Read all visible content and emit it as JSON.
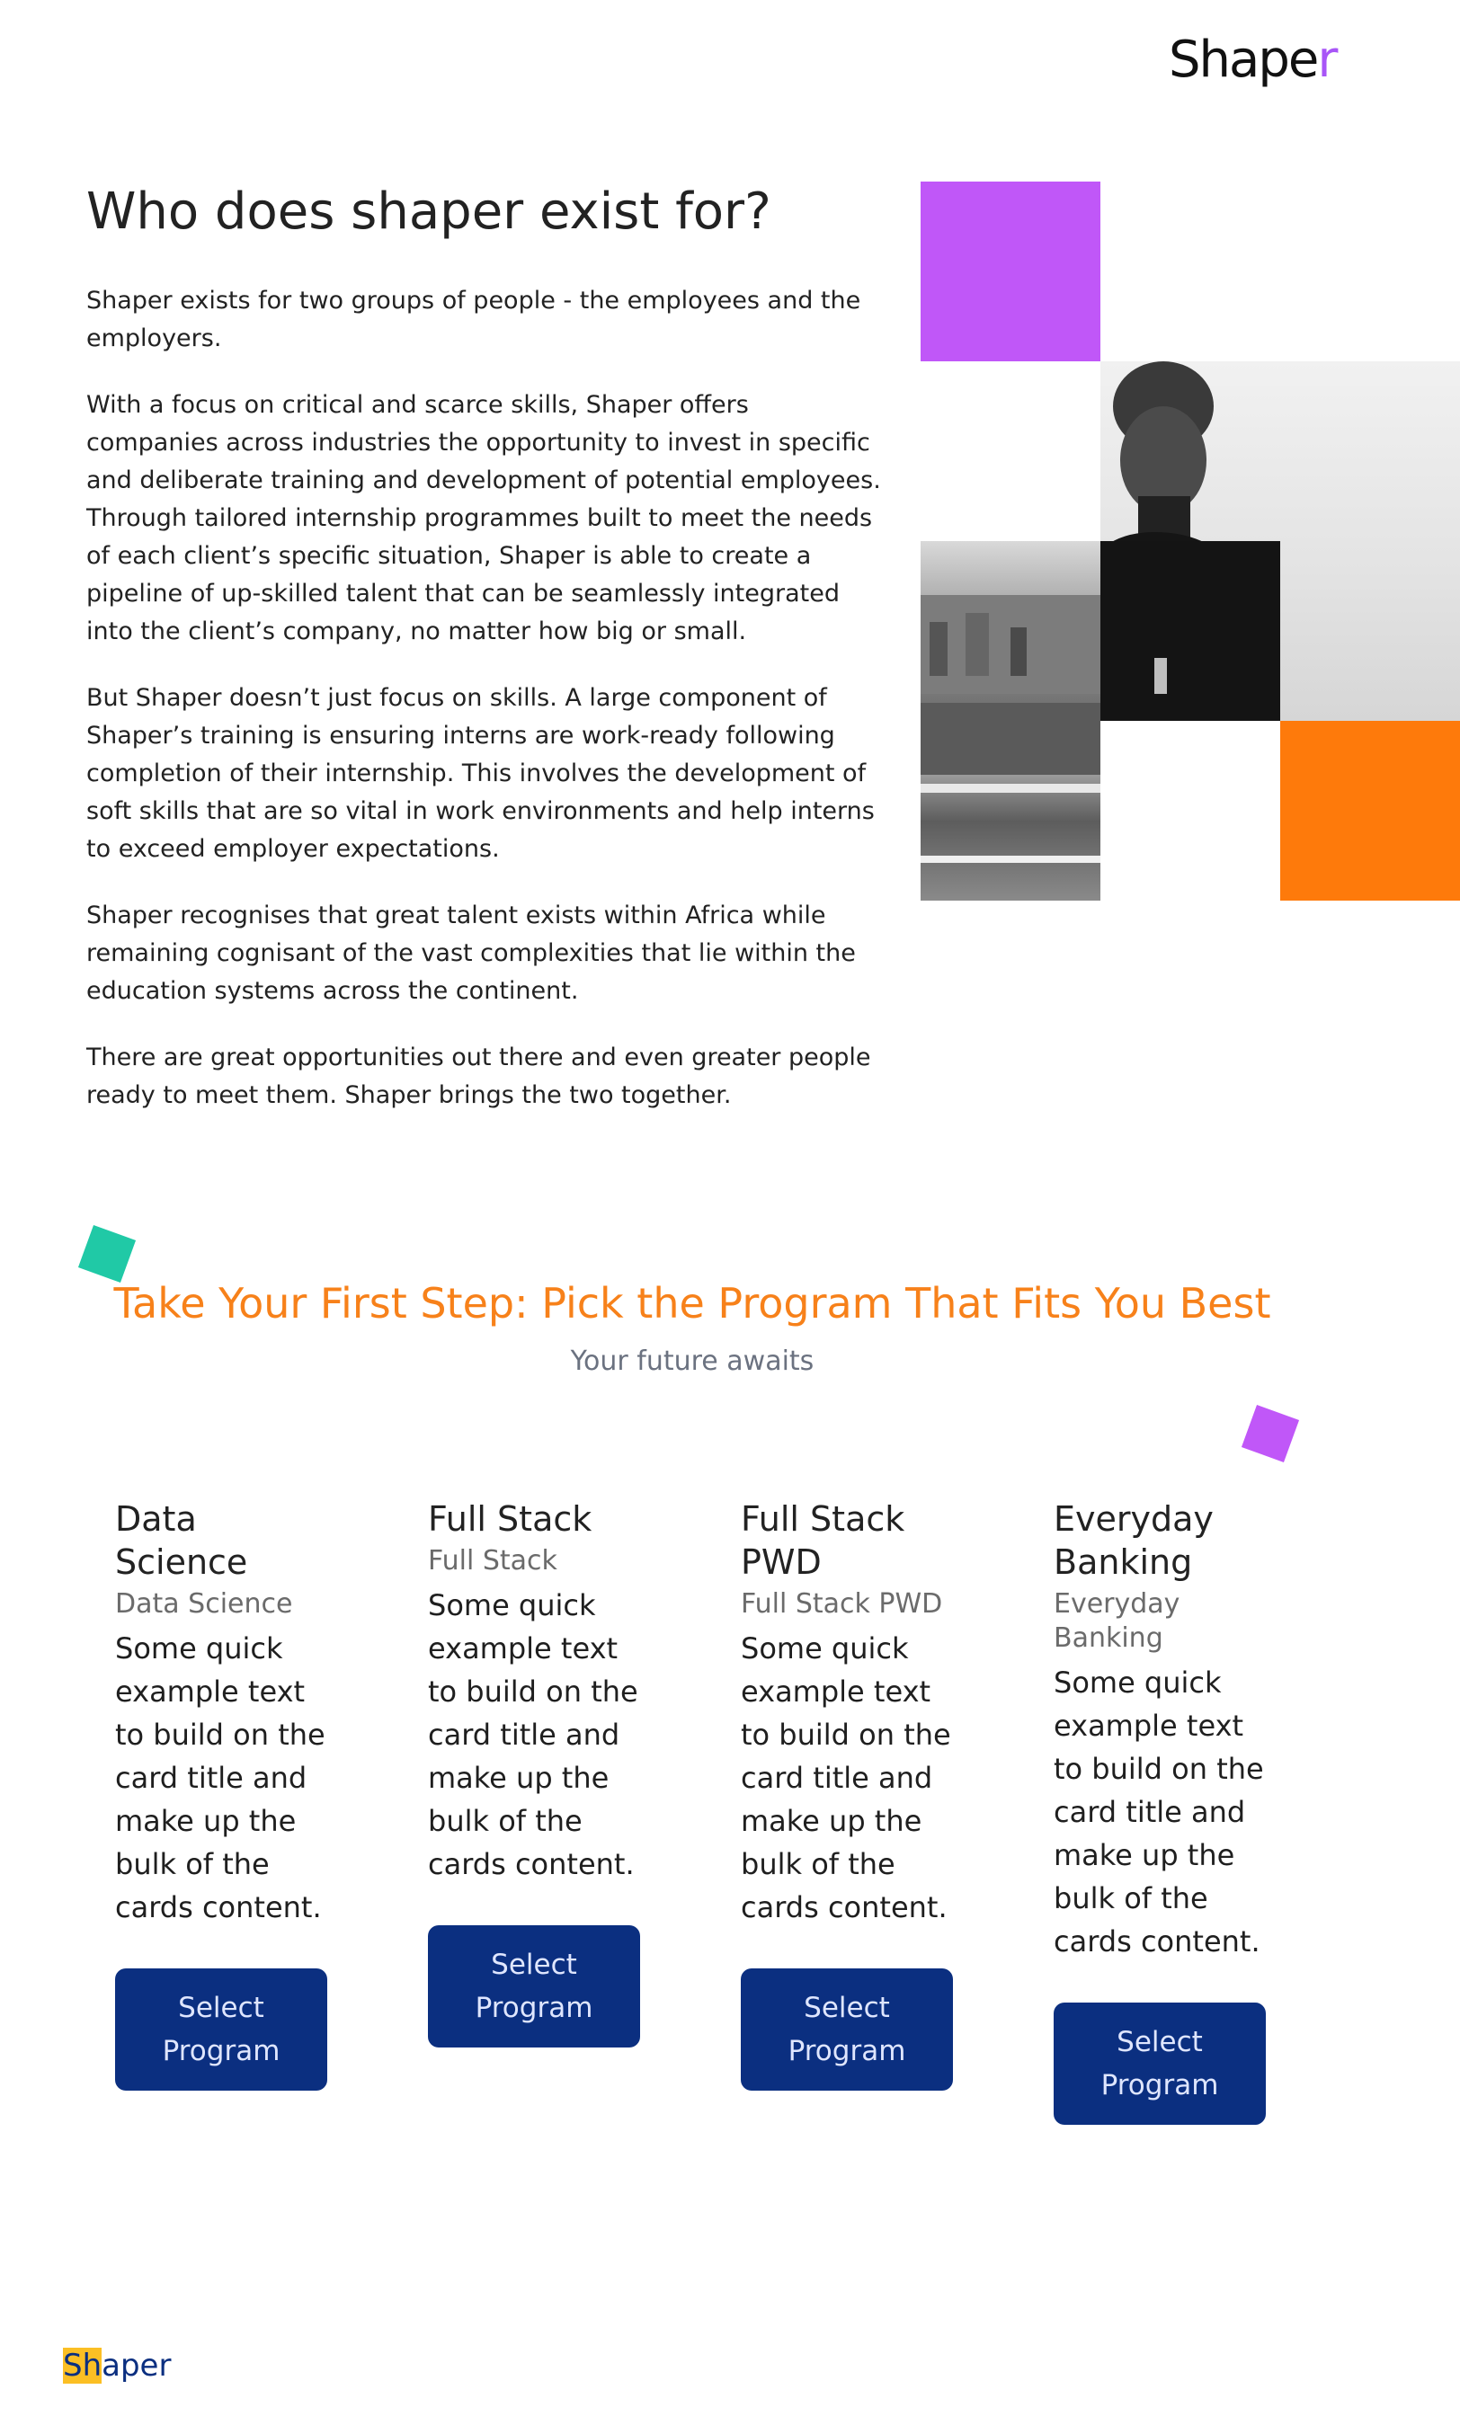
{
  "header": {
    "logo_text": "Shape",
    "logo_tail": "r"
  },
  "intro": {
    "title": "Who does shaper exist for?",
    "paragraphs": [
      "Shaper exists for two groups of people - the employees and the employers.",
      "With a focus on critical and scarce skills, Shaper offers companies across industries the opportunity to invest in specific and deliberate training and development of potential employees. Through tailored internship programmes built to meet the needs of each client’s specific situation, Shaper is able to create a pipeline of up-skilled talent that can be seamlessly integrated into the client’s company, no matter how big or small.",
      "But Shaper doesn’t just focus on skills. A large component of Shaper’s training is ensuring interns are work-ready following completion of their internship. This involves the development of soft skills that are so vital in work environments and help interns to exceed employer expectations.",
      "Shaper recognises that great talent exists within Africa while remaining cognisant of the vast complexities that lie within the education systems across the continent.",
      "There are great opportunities out there and even greater people ready to meet them. Shaper brings the two together."
    ]
  },
  "collage": {
    "colors": {
      "purple": "#c057f8",
      "orange": "#fe7a0b"
    }
  },
  "programs": {
    "heading": "Take Your First Step: Pick the Program That Fits You Best",
    "subheading": "Your future awaits",
    "accent_color": "#f7811a",
    "button_color": "#0b2f80",
    "cards": [
      {
        "title": "Data Science",
        "subtitle": "Data Science",
        "text": "Some quick example text to build on the card title and make up the bulk of the cards content.",
        "button": "Select Program"
      },
      {
        "title": "Full Stack",
        "subtitle": "Full Stack",
        "text": "Some quick example text to build on the card title and make up the bulk of the cards content.",
        "button": "Select Program"
      },
      {
        "title": "Full Stack PWD",
        "subtitle": "Full Stack PWD",
        "text": "Some quick example text to build on the card title and make up the bulk of the cards content.",
        "button": "Select Program"
      },
      {
        "title": "Everyday Banking",
        "subtitle": "Everyday Banking",
        "text": "Some quick example text to build on the card title and make up the bulk of the cards content.",
        "button": "Select Program"
      }
    ]
  },
  "footer": {
    "logo_highlight": "Sh",
    "logo_rest": "aper"
  }
}
